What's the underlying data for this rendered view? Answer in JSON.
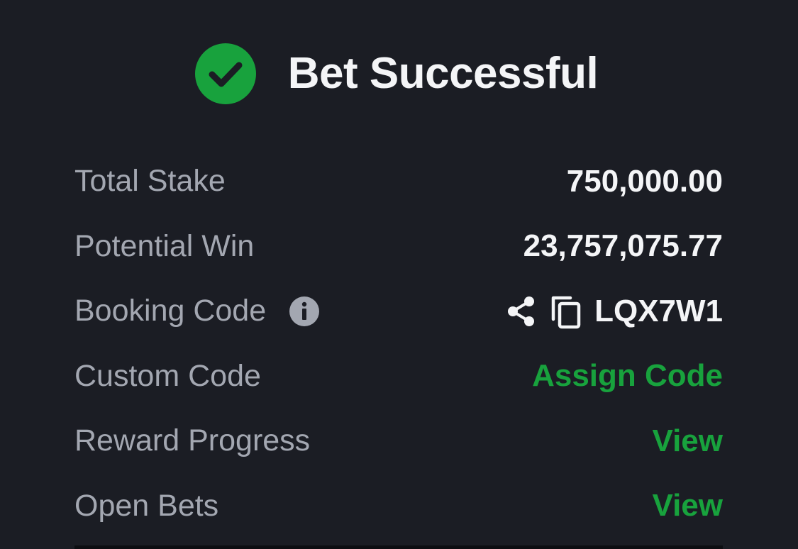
{
  "header": {
    "title": "Bet Successful",
    "icon": "check-circle-icon",
    "accent_color": "#18a23d"
  },
  "details": {
    "total_stake": {
      "label": "Total Stake",
      "value": "750,000.00"
    },
    "potential_win": {
      "label": "Potential Win",
      "value": "23,757,075.77"
    },
    "booking_code": {
      "label": "Booking Code",
      "value": "LQX7W1",
      "info_icon": "info-icon",
      "share_icon": "share-icon",
      "copy_icon": "copy-icon"
    },
    "custom_code": {
      "label": "Custom Code",
      "action": "Assign Code"
    },
    "reward_progress": {
      "label": "Reward Progress",
      "action": "View"
    },
    "open_bets": {
      "label": "Open Bets",
      "action": "View"
    }
  },
  "colors": {
    "background": "#1b1d24",
    "label": "#a3a7b1",
    "value": "#f4f5f7",
    "link": "#18a23d"
  }
}
